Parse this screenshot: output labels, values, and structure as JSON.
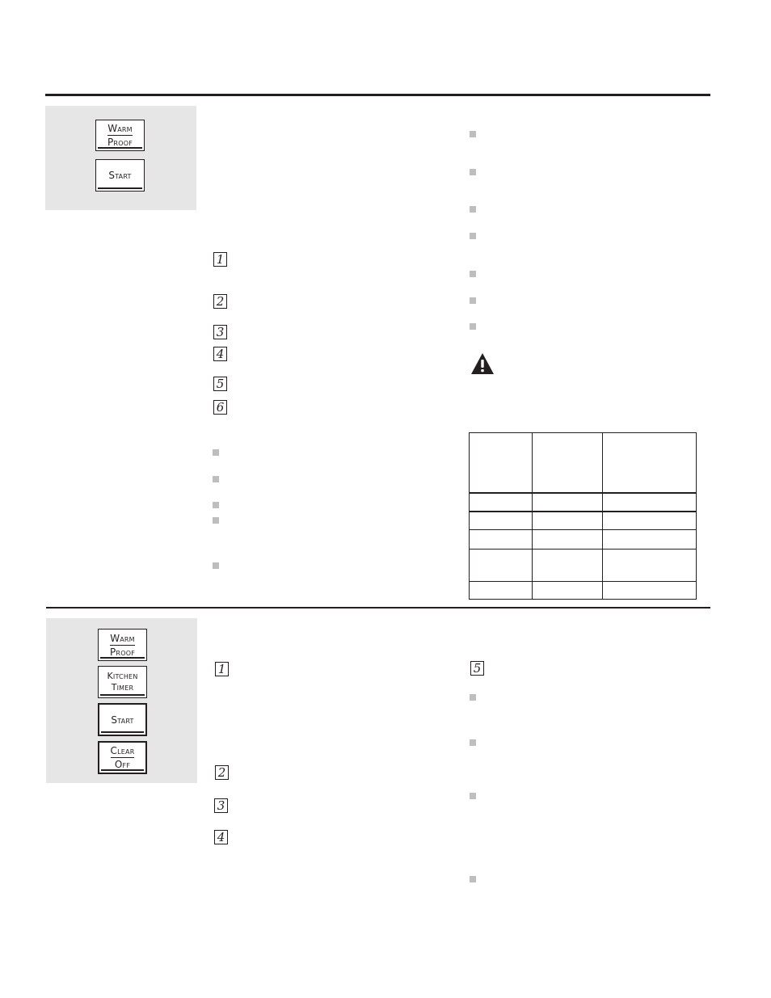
{
  "section1": {
    "keys": [
      {
        "line1": "Warm",
        "line2": "Proof"
      },
      {
        "line1": "Start",
        "line2": ""
      }
    ],
    "steps": [
      "1",
      "2",
      "3",
      "4",
      "5",
      "6"
    ],
    "left_bullets": 5,
    "right_bullets": 7,
    "warning_icon": "warning-triangle-icon",
    "table": {
      "columns": 3,
      "header": [
        "",
        "",
        ""
      ],
      "rows": [
        [
          "",
          "",
          ""
        ],
        [
          "",
          "",
          ""
        ],
        [
          "",
          "",
          ""
        ],
        [
          "",
          "",
          ""
        ],
        [
          "",
          "",
          ""
        ]
      ]
    }
  },
  "section2": {
    "keys": [
      {
        "line1": "Warm",
        "line2": "Proof"
      },
      {
        "line1": "Kitchen",
        "line2": "Timer"
      },
      {
        "line1": "Start",
        "line2": ""
      },
      {
        "line1": "Clear",
        "line2": "Off"
      }
    ],
    "steps_left": [
      "1",
      "2",
      "3",
      "4"
    ],
    "steps_right": [
      "5"
    ],
    "right_bullets": 4
  },
  "colors": {
    "rule": "#231f20",
    "panel": "#e6e6e6",
    "bullet": "#bcbec0"
  }
}
